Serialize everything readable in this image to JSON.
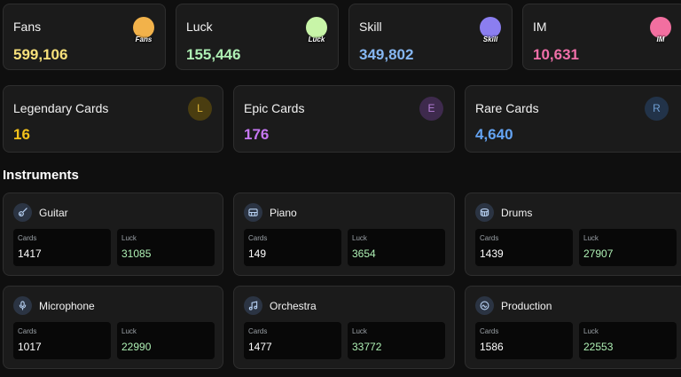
{
  "stats": [
    {
      "label": "Fans",
      "value": "599,106",
      "color": "#f7e07a",
      "icon": "fans-icon",
      "icon_text": "Fans",
      "icon_color": "#f2b24a"
    },
    {
      "label": "Luck",
      "value": "155,446",
      "color": "#aef0b4",
      "icon": "luck-clover-icon",
      "icon_text": "Luck",
      "icon_color": "#c8f5a8"
    },
    {
      "label": "Skill",
      "value": "349,802",
      "color": "#86b7f2",
      "icon": "skill-icon",
      "icon_text": "Skill",
      "icon_color": "#8b7ef0"
    },
    {
      "label": "IM",
      "value": "10,631",
      "color": "#ef6fa8",
      "icon": "im-icon",
      "icon_text": "IM",
      "icon_color": "#f26fa0"
    }
  ],
  "rarities": [
    {
      "label": "Legendary Cards",
      "value": "16",
      "letter": "L",
      "color": "#f4c21b",
      "badge_bg": "#4a3d10",
      "badge_fg": "#e2b93a"
    },
    {
      "label": "Epic Cards",
      "value": "176",
      "letter": "E",
      "color": "#c677f2",
      "badge_bg": "#3e2a4d",
      "badge_fg": "#b47ed6"
    },
    {
      "label": "Rare Cards",
      "value": "4,640",
      "letter": "R",
      "color": "#64a4f4",
      "badge_bg": "#223349",
      "badge_fg": "#6f9fd4"
    }
  ],
  "section_title": "Instruments",
  "sub_labels": {
    "cards": "Cards",
    "luck": "Luck"
  },
  "instruments": [
    {
      "name": "Guitar",
      "icon": "guitar-icon",
      "cards": "1417",
      "luck": "31085"
    },
    {
      "name": "Piano",
      "icon": "piano-icon",
      "cards": "149",
      "luck": "3654"
    },
    {
      "name": "Drums",
      "icon": "drum-icon",
      "cards": "1439",
      "luck": "27907"
    },
    {
      "name": "Microphone",
      "icon": "microphone-icon",
      "cards": "1017",
      "luck": "22990"
    },
    {
      "name": "Orchestra",
      "icon": "music-note-icon",
      "cards": "1477",
      "luck": "33772"
    },
    {
      "name": "Production",
      "icon": "production-icon",
      "cards": "1586",
      "luck": "22553"
    }
  ],
  "colors": {
    "luck_value": "#aef0b4",
    "card_value": "#ffffff",
    "icon_bg": "#2b3443",
    "icon_fg": "#b9d3f5"
  }
}
